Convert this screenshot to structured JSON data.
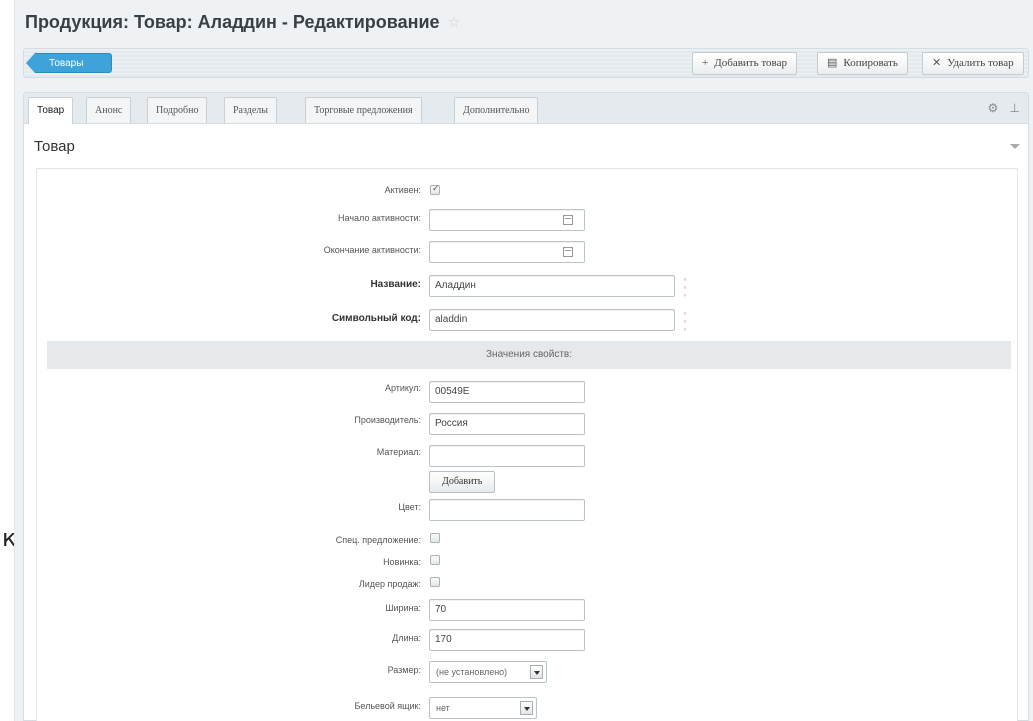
{
  "page": {
    "title": "Продукция: Товар: Аладдин - Редактирование"
  },
  "edge_char": "к",
  "toolbar": {
    "back_label": "Товары",
    "add_label": "Добавить товар",
    "copy_label": "Копировать",
    "delete_label": "Удалить товар"
  },
  "tabs": [
    {
      "label": "Товар",
      "active": true
    },
    {
      "label": "Анонс",
      "active": false
    },
    {
      "label": "Подробно",
      "active": false
    },
    {
      "label": "Разделы",
      "active": false
    },
    {
      "label": "Торговые предложения",
      "active": false
    },
    {
      "label": "Дополнительно",
      "active": false
    }
  ],
  "section": {
    "title": "Товар"
  },
  "form": {
    "active_label": "Активен:",
    "active_checked": true,
    "start_label": "Начало активности:",
    "start_value": "",
    "end_label": "Окончание активности:",
    "end_value": "",
    "name_label": "Название:",
    "name_value": "Аладдин",
    "code_label": "Символьный код:",
    "code_value": "aladdin",
    "properties_header": "Значения свойств:",
    "article_label": "Артикул:",
    "article_value": "00549Е",
    "maker_label": "Производитель:",
    "maker_value": "Россия",
    "material_label": "Материал:",
    "material_value": "",
    "add_button": "Добавить",
    "color_label": "Цвет:",
    "color_value": "",
    "special_label": "Спец. предложение:",
    "new_label": "Новинка:",
    "leader_label": "Лидер продаж:",
    "width_label": "Ширина:",
    "width_value": "70",
    "length_label": "Длина:",
    "length_value": "170",
    "size_label": "Размер:",
    "size_value": "(не установлено)",
    "linen_label": "Бельевой ящик:",
    "linen_value": "нет"
  }
}
